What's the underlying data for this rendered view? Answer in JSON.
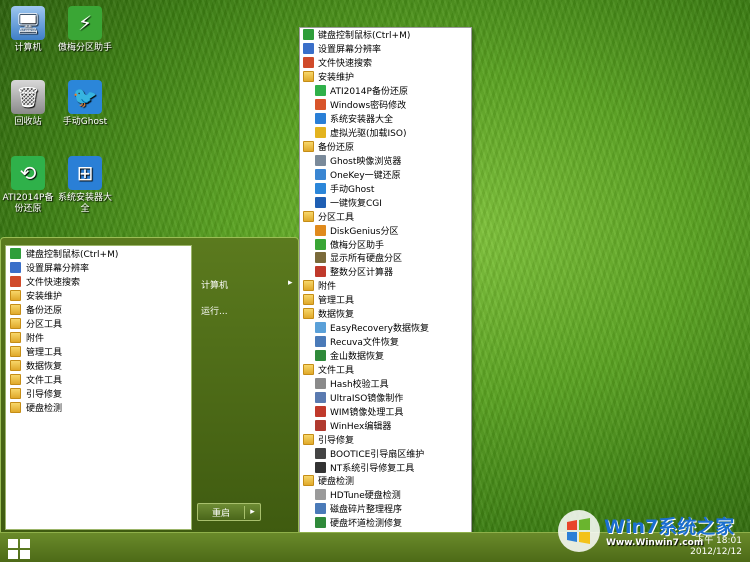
{
  "desktop_icons": [
    {
      "label": "计算机",
      "icon": "computer-icon",
      "color": "#4a8fd8"
    },
    {
      "label": "傲梅分区助手",
      "icon": "partition-assistant-icon",
      "color": "#3aa635"
    },
    {
      "label": "回收站",
      "icon": "recycle-bin-icon",
      "color": "#8a8a8a"
    },
    {
      "label": "手动Ghost",
      "icon": "ghost-bird-icon",
      "color": "#2b86d9"
    },
    {
      "label": "ATI2014P备份还原",
      "icon": "backup-restore-icon",
      "color": "#2fb14a"
    },
    {
      "label": "系统安装器大全",
      "icon": "windows-installer-icon",
      "color": "#2a7fd6"
    }
  ],
  "start_menu": {
    "left_items": [
      {
        "label": "键盘控制鼠标(Ctrl+M)",
        "icon": "keyboard-mouse-icon",
        "color": "#2f9e3a"
      },
      {
        "label": "设置屏幕分辨率",
        "icon": "screen-resolution-icon",
        "color": "#3a6fc9"
      },
      {
        "label": "文件快速搜索",
        "icon": "file-search-icon",
        "color": "#d04a2a"
      },
      {
        "label": "安装维护",
        "icon": "folder-icon"
      },
      {
        "label": "备份还原",
        "icon": "folder-icon"
      },
      {
        "label": "分区工具",
        "icon": "folder-icon"
      },
      {
        "label": "附件",
        "icon": "folder-icon"
      },
      {
        "label": "管理工具",
        "icon": "folder-icon"
      },
      {
        "label": "数据恢复",
        "icon": "folder-icon"
      },
      {
        "label": "文件工具",
        "icon": "folder-icon"
      },
      {
        "label": "引导修复",
        "icon": "folder-icon"
      },
      {
        "label": "硬盘检测",
        "icon": "folder-icon"
      }
    ],
    "right_computer": "计算机",
    "right_run": "运行...",
    "restart": "重启",
    "restart_arrow": "▸"
  },
  "submenu": [
    {
      "label": "键盘控制鼠标(Ctrl+M)",
      "level": 1,
      "icon": "keyboard-mouse-icon",
      "color": "#2f9e3a"
    },
    {
      "label": "设置屏幕分辨率",
      "level": 1,
      "icon": "screen-resolution-icon",
      "color": "#3a6fc9"
    },
    {
      "label": "文件快速搜索",
      "level": 1,
      "icon": "file-search-icon",
      "color": "#d04a2a"
    },
    {
      "label": "安装维护",
      "level": 1,
      "icon": "folder-icon"
    },
    {
      "label": "ATI2014P备份还原",
      "level": 2,
      "icon": "backup-restore-icon",
      "color": "#2fb14a"
    },
    {
      "label": "Windows密码修改",
      "level": 2,
      "icon": "password-icon",
      "color": "#d8542a"
    },
    {
      "label": "系统安装器大全",
      "level": 2,
      "icon": "windows-installer-icon",
      "color": "#2a7fd6"
    },
    {
      "label": "虚拟光驱(加载ISO)",
      "level": 2,
      "icon": "virtual-drive-icon",
      "color": "#e3b31e"
    },
    {
      "label": "备份还原",
      "level": 1,
      "icon": "folder-icon"
    },
    {
      "label": "Ghost映像浏览器",
      "level": 2,
      "icon": "ghost-explorer-icon",
      "color": "#7a8a9a"
    },
    {
      "label": "OneKey一键还原",
      "level": 2,
      "icon": "onekey-icon",
      "color": "#3a86d2"
    },
    {
      "label": "手动Ghost",
      "level": 2,
      "icon": "ghost-bird-icon",
      "color": "#2b86d9"
    },
    {
      "label": "一键恢复CGI",
      "level": 2,
      "icon": "cgi-icon",
      "color": "#1f5fb3"
    },
    {
      "label": "分区工具",
      "level": 1,
      "icon": "folder-icon"
    },
    {
      "label": "DiskGenius分区",
      "level": 2,
      "icon": "diskgenius-icon",
      "color": "#e08a1c"
    },
    {
      "label": "傲梅分区助手",
      "level": 2,
      "icon": "partition-assistant-icon",
      "color": "#3aa635"
    },
    {
      "label": "显示所有硬盘分区",
      "level": 2,
      "icon": "show-partitions-icon",
      "color": "#7a6a3a"
    },
    {
      "label": "整数分区计算器",
      "level": 2,
      "icon": "calculator-icon",
      "color": "#c0392b"
    },
    {
      "label": "附件",
      "level": 1,
      "icon": "folder-icon"
    },
    {
      "label": "管理工具",
      "level": 1,
      "icon": "folder-icon"
    },
    {
      "label": "数据恢复",
      "level": 1,
      "icon": "folder-icon"
    },
    {
      "label": "EasyRecovery数据恢复",
      "level": 2,
      "icon": "easyrecovery-icon",
      "color": "#5aa0d8"
    },
    {
      "label": "Recuva文件恢复",
      "level": 2,
      "icon": "recuva-icon",
      "color": "#4a7ab8"
    },
    {
      "label": "金山数据恢复",
      "level": 2,
      "icon": "kingsoft-recovery-icon",
      "color": "#2f8a3a"
    },
    {
      "label": "文件工具",
      "level": 1,
      "icon": "folder-icon"
    },
    {
      "label": "Hash校验工具",
      "level": 2,
      "icon": "hash-icon",
      "color": "#8a8a8a"
    },
    {
      "label": "UltraISO镜像制作",
      "level": 2,
      "icon": "ultraiso-icon",
      "color": "#5a7ab0"
    },
    {
      "label": "WIM镜像处理工具",
      "level": 2,
      "icon": "wim-icon",
      "color": "#c0392b"
    },
    {
      "label": "WinHex编辑器",
      "level": 2,
      "icon": "winhex-icon",
      "color": "#b03a2e"
    },
    {
      "label": "引导修复",
      "level": 1,
      "icon": "folder-icon"
    },
    {
      "label": "BOOTICE引导扇区维护",
      "level": 2,
      "icon": "bootice-icon",
      "color": "#444444"
    },
    {
      "label": "NT系统引导修复工具",
      "level": 2,
      "icon": "nt-boot-icon",
      "color": "#333333"
    },
    {
      "label": "硬盘检测",
      "level": 1,
      "icon": "folder-icon"
    },
    {
      "label": "HDTune硬盘检测",
      "level": 2,
      "icon": "hdtune-icon",
      "color": "#9a9a9a"
    },
    {
      "label": "磁盘碎片整理程序",
      "level": 2,
      "icon": "defrag-icon",
      "color": "#4a7ab8"
    },
    {
      "label": "硬盘坏道检测修复",
      "level": 2,
      "icon": "bad-sector-icon",
      "color": "#2f8a3a"
    }
  ],
  "taskbar": {
    "time": "下午 18:01",
    "date": "2012/12/12"
  },
  "watermark": {
    "text": "Win7系统之家",
    "url": "Www.Winwin7.com"
  }
}
